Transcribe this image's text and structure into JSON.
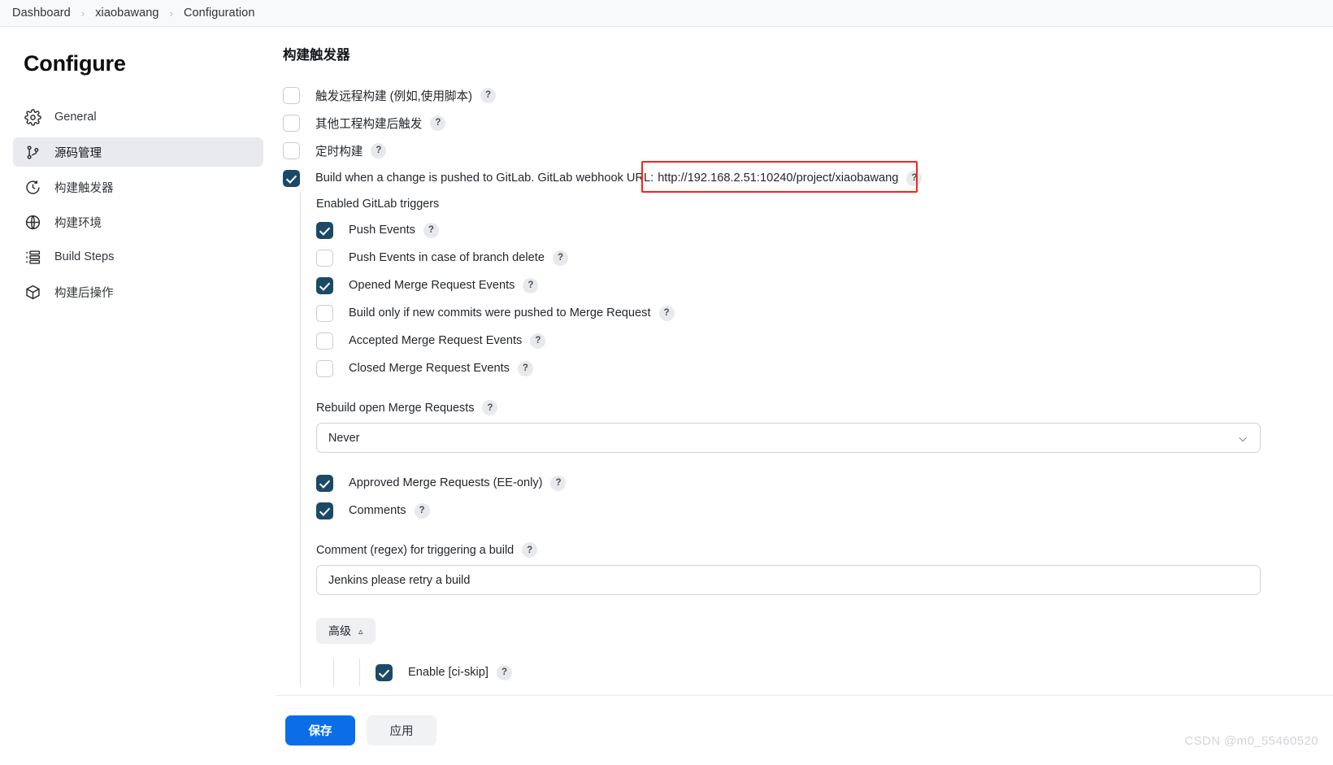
{
  "breadcrumb": {
    "items": [
      "Dashboard",
      "xiaobawang",
      "Configuration"
    ],
    "separator": "›"
  },
  "sidebar": {
    "title": "Configure",
    "items": [
      {
        "label": "General",
        "icon": "gear-icon",
        "active": false
      },
      {
        "label": "源码管理",
        "icon": "branch-icon",
        "active": true
      },
      {
        "label": "构建触发器",
        "icon": "clock-icon",
        "active": false
      },
      {
        "label": "构建环境",
        "icon": "globe-icon",
        "active": false
      },
      {
        "label": "Build Steps",
        "icon": "list-steps-icon",
        "active": false
      },
      {
        "label": "构建后操作",
        "icon": "package-icon",
        "active": false
      }
    ]
  },
  "main": {
    "section_title": "构建触发器",
    "help_glyph": "?",
    "top_triggers": [
      {
        "label": "触发远程构建 (例如,使用脚本)",
        "checked": false
      },
      {
        "label": "其他工程构建后触发",
        "checked": false
      },
      {
        "label": "定时构建",
        "checked": false
      }
    ],
    "gitlab": {
      "checked": true,
      "label_prefix": "Build when a change is pushed to GitLab. GitLab webhook URL:",
      "webhook_url": "http://192.168.2.51:10240/project/xiaobawang",
      "group_title": "Enabled GitLab triggers",
      "triggers": [
        {
          "label": "Push Events",
          "checked": true
        },
        {
          "label": "Push Events in case of branch delete",
          "checked": false
        },
        {
          "label": "Opened Merge Request Events",
          "checked": true
        },
        {
          "label": "Build only if new commits were pushed to Merge Request",
          "checked": false
        },
        {
          "label": "Accepted Merge Request Events",
          "checked": false
        },
        {
          "label": "Closed Merge Request Events",
          "checked": false
        }
      ],
      "rebuild_label": "Rebuild open Merge Requests",
      "rebuild_value": "Never",
      "rebuild_chevron": "⌄",
      "post_triggers": [
        {
          "label": "Approved Merge Requests (EE-only)",
          "checked": true
        },
        {
          "label": "Comments",
          "checked": true
        }
      ],
      "comment_regex_label": "Comment (regex) for triggering a build",
      "comment_regex_value": "Jenkins please retry a build",
      "advanced_label": "高级",
      "advanced_chevron": "⌃",
      "advanced_items": [
        {
          "label": "Enable [ci-skip]",
          "checked": true
        }
      ]
    }
  },
  "actions": {
    "save_label": "保存",
    "apply_label": "应用"
  },
  "watermark": "CSDN @m0_55460520",
  "colors": {
    "accent_blue": "#0b6ee8",
    "checkbox_on": "#1b4a66",
    "annotation_red": "#f8231b",
    "sidebar_active": "#e9eaee"
  }
}
